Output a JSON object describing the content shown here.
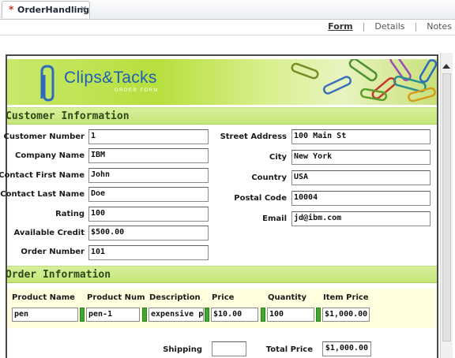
{
  "tab": {
    "dirty_marker": "*",
    "title": "OrderHandling",
    "close": "✕"
  },
  "views": {
    "form": "Form",
    "sep": "|",
    "details": "Details",
    "notes": "Notes"
  },
  "banner": {
    "brand": "Clips&Tacks",
    "subtitle": "ORDER FORM"
  },
  "customer": {
    "header": "Customer Information",
    "left": [
      {
        "label": "Customer Number",
        "value": "1"
      },
      {
        "label": "Company Name",
        "value": "IBM"
      },
      {
        "label": "Contact First Name",
        "value": "John"
      },
      {
        "label": "Contact Last Name",
        "value": "Doe"
      },
      {
        "label": "Rating",
        "value": "100"
      },
      {
        "label": "Available Credit",
        "value": "$500.00"
      },
      {
        "label": "Order Number",
        "value": "101"
      }
    ],
    "right": [
      {
        "label": "Street Address",
        "value": "100 Main St"
      },
      {
        "label": "City",
        "value": "New York"
      },
      {
        "label": "Country",
        "value": "USA"
      },
      {
        "label": "Postal Code",
        "value": "10004"
      },
      {
        "label": "Email",
        "value": "jd@ibm.com"
      }
    ]
  },
  "order": {
    "header": "Order Information",
    "columns": [
      "Product Name",
      "Product Num",
      "Description",
      "Price",
      "Quantity",
      "Item Price"
    ],
    "row": [
      "pen",
      "pen-1",
      "expensive pen",
      "$10.00",
      "100",
      "$1,000.00"
    ],
    "shipping_label": "Shipping",
    "shipping_value": "",
    "total_label": "Total Price",
    "total_value": "$1,000.00"
  },
  "colors": {
    "accent_green": "#c4e67a",
    "row_bg": "#ffffe0",
    "brand_blue": "#1e5fb8"
  },
  "icons": {
    "tab_close": "close-icon",
    "banner": "paperclip-icon",
    "scroll": "arrow-up-icon"
  }
}
